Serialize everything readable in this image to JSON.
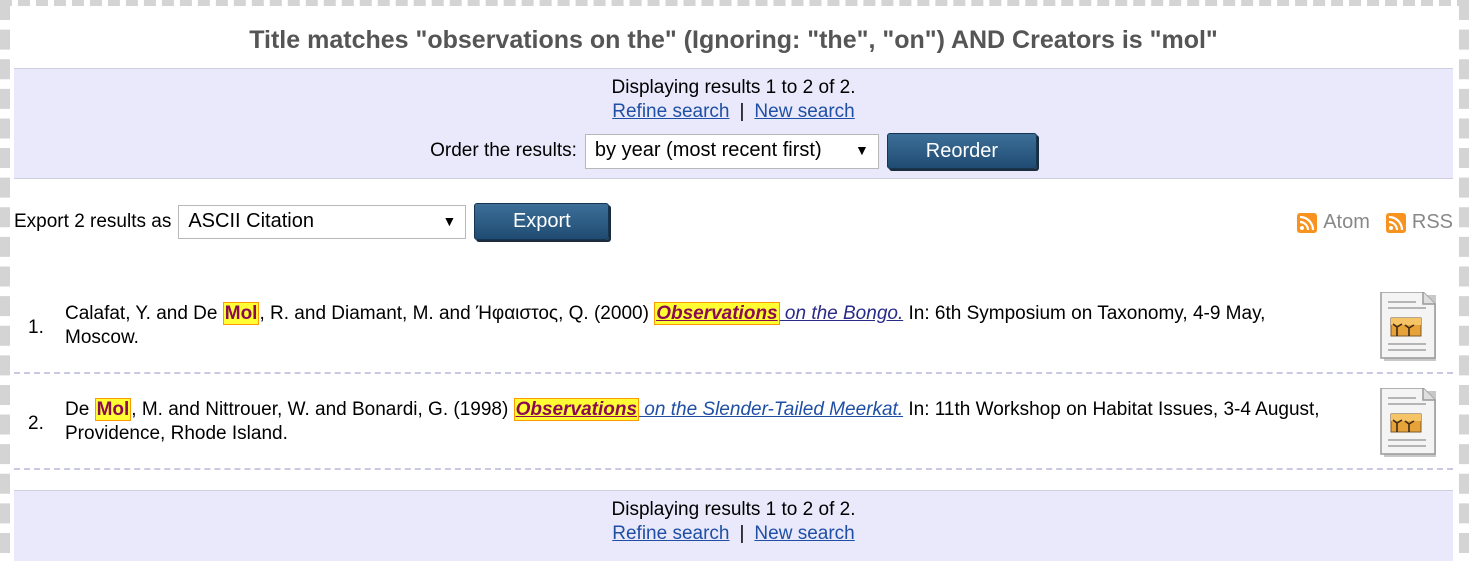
{
  "search": {
    "heading": "Title matches \"observations on the\" (Ignoring: \"the\", \"on\") AND Creators is \"mol\""
  },
  "nav": {
    "displaying": "Displaying results 1 to 2 of 2.",
    "refine": "Refine search",
    "separator": "|",
    "new_search": "New search"
  },
  "order": {
    "label": "Order the results:",
    "selected": "by year (most recent first)",
    "button": "Reorder"
  },
  "export": {
    "label": "Export 2 results as",
    "selected": "ASCII Citation",
    "button": "Export"
  },
  "feeds": {
    "atom": "Atom",
    "rss": "RSS",
    "icon": "rss-feed-icon"
  },
  "results": [
    {
      "num": "1.",
      "authors_before": "Calafat, Y. and De ",
      "author_match": "Mol",
      "authors_after": ", R. and Diamant, M. and Ήφαιστος, Q. (2000) ",
      "title_match": "Observations",
      "title_rest": " on the Bongo.",
      "details": " In: 6th Symposium on Taxonomy, 4-9 May, Moscow."
    },
    {
      "num": "2.",
      "authors_before": "De ",
      "author_match": "Mol",
      "authors_after": ", M. and Nittrouer, W. and Bonardi, G. (1998) ",
      "title_match": "Observations",
      "title_rest": " on the Slender-Tailed Meerkat.",
      "details": " In: 11th Workshop on Habitat Issues, 3-4 August, Providence, Rhode Island."
    }
  ],
  "colors": {
    "band": "#e9e9fb",
    "button": "#2b5a82",
    "highlight": "#ffff33",
    "highlight_text": "#8b0b52",
    "link": "#1f4fa5",
    "feed_orange": "#f7931e"
  }
}
